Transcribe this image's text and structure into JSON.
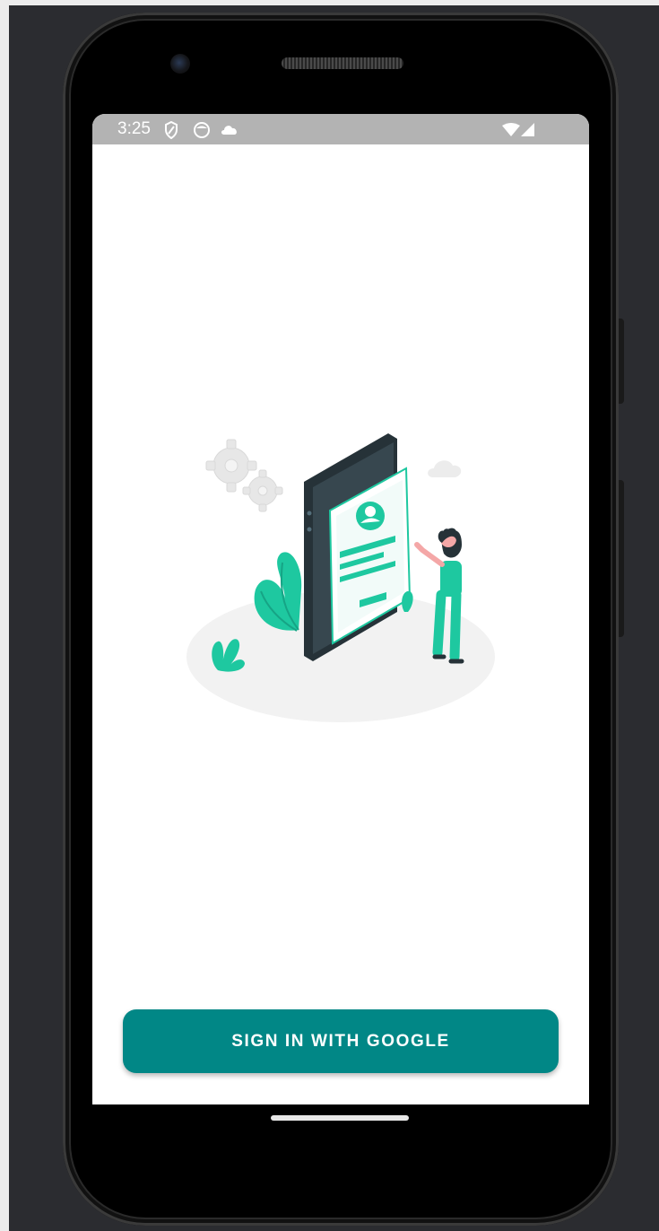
{
  "status_bar": {
    "time": "3:25",
    "icons": [
      "shield-icon",
      "face-icon",
      "cloud-icon",
      "wifi-icon",
      "cellular-icon"
    ]
  },
  "illustration": {
    "name": "login-illustration"
  },
  "signin": {
    "label": "SIGN IN WITH GOOGLE"
  },
  "colors": {
    "accent": "#018786",
    "illustration_accent": "#1ec8a0",
    "phone_body": "#263238",
    "status_bar": "#b3b3b3"
  }
}
